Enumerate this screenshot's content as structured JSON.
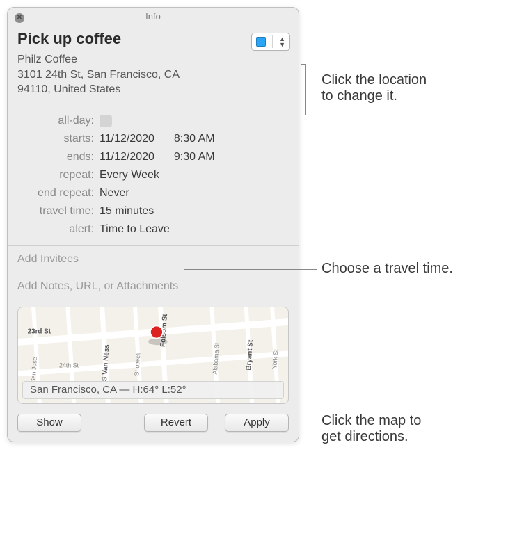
{
  "window": {
    "title": "Info"
  },
  "event": {
    "title": "Pick up coffee",
    "location": {
      "name": "Philz Coffee",
      "address1": "3101 24th St, San Francisco, CA",
      "address2": "94110, United States"
    }
  },
  "details": {
    "labels": {
      "allday": "all-day:",
      "starts": "starts:",
      "ends": "ends:",
      "repeat": "repeat:",
      "endrepeat": "end repeat:",
      "traveltime": "travel time:",
      "alert": "alert:"
    },
    "allday_checked": false,
    "starts_date": "11/12/2020",
    "starts_time": "8:30 AM",
    "ends_date": "11/12/2020",
    "ends_time": "9:30 AM",
    "repeat": "Every Week",
    "endrepeat": "Never",
    "traveltime": "15 minutes",
    "alert": "Time to Leave"
  },
  "invitees_placeholder": "Add Invitees",
  "notes_placeholder": "Add Notes, URL, or Attachments",
  "map": {
    "weather": "San Francisco, CA — H:64° L:52°",
    "streets": {
      "s1": "23rd St",
      "s2": "24th St",
      "v1": "San Jose",
      "v2": "S Van Ness",
      "v3": "Shotwell",
      "v4": "Folsom St",
      "v5": "Alabama St",
      "v6": "Bryant St",
      "v7": "York St"
    }
  },
  "buttons": {
    "show": "Show",
    "revert": "Revert",
    "apply": "Apply"
  },
  "callouts": {
    "location1": "Click the location",
    "location2": "to change it.",
    "travel": "Choose a travel time.",
    "map1": "Click the map to",
    "map2": "get directions."
  }
}
